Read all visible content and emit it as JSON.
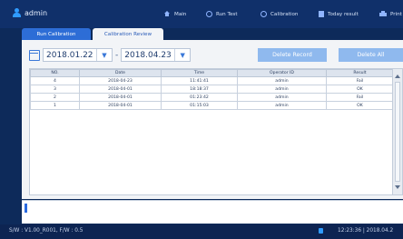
{
  "header": {
    "user": "admin",
    "nav": [
      {
        "label": "Main",
        "icon": "home-icon"
      },
      {
        "label": "Run Test",
        "icon": "circle-icon"
      },
      {
        "label": "Calibration",
        "icon": "circle-icon"
      },
      {
        "label": "Today result",
        "icon": "document-icon"
      },
      {
        "label": "Print",
        "icon": "printer-icon"
      }
    ]
  },
  "tabs": [
    {
      "label": "Run Calibration",
      "active": false
    },
    {
      "label": "Calibration Review",
      "active": true
    }
  ],
  "filter": {
    "from_date": "2018.01.22",
    "separator": "-",
    "to_date": "2018.04.23"
  },
  "buttons": {
    "delete_record": "Delete Record",
    "delete_all": "Delete All"
  },
  "table": {
    "columns": [
      "NO.",
      "Date",
      "Time",
      "Operator ID",
      "Result"
    ],
    "rows": [
      [
        "4",
        "2018-04-23",
        "11:41:41",
        "admin",
        "Fail"
      ],
      [
        "3",
        "2018-04-01",
        "18:18:37",
        "admin",
        "OK"
      ],
      [
        "2",
        "2018-04-01",
        "01:23:42",
        "admin",
        "Fail"
      ],
      [
        "1",
        "2018-04-01",
        "01:15:03",
        "admin",
        "OK"
      ]
    ]
  },
  "status": {
    "version": "S/W : V1.00_R001, F/W : 0.5",
    "clock": "12:23:36 | 2018.04.2"
  },
  "colors": {
    "background": "#0d2a5a",
    "accent": "#2d6dd6",
    "button_disabled": "#8fb9ee"
  }
}
